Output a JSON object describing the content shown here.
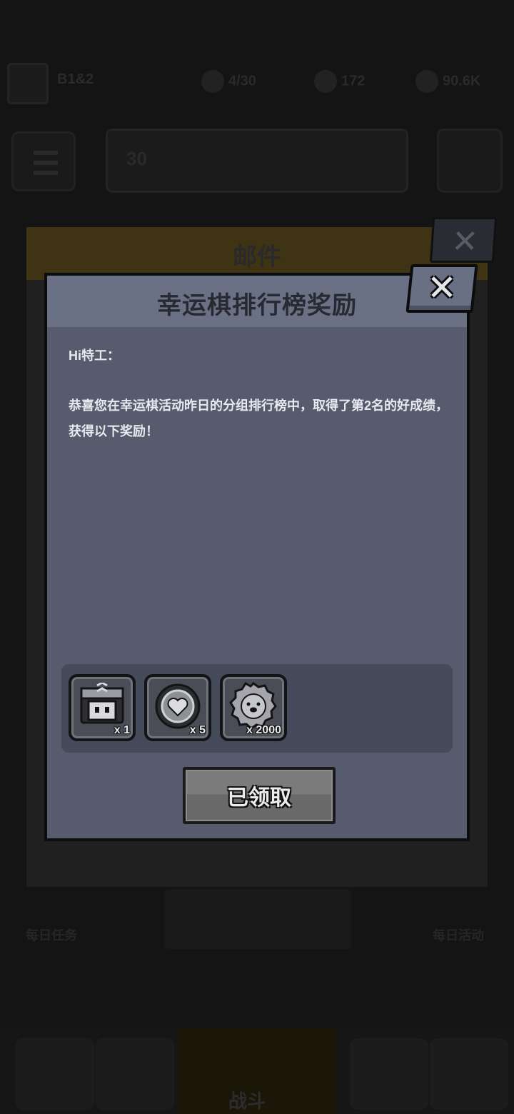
{
  "background": {
    "player_name": "B1&2",
    "resources": [
      {
        "icon": "energy-icon",
        "value": "4/30"
      },
      {
        "icon": "gem-icon",
        "value": "172"
      },
      {
        "icon": "coin-icon",
        "value": "90.6K"
      }
    ],
    "level": "30",
    "mail_window_title": "邮件",
    "bottom_labels": {
      "left": "每日任务",
      "right": "每日活动"
    },
    "battle_label": "战斗"
  },
  "dialog": {
    "title": "幸运棋排行榜奖励",
    "greeting": "Hi特工：",
    "body": "恭喜您在幸运棋活动昨日的分组排行榜中，取得了第2名的好成绩，获得以下奖励！",
    "rewards": [
      {
        "icon": "treasure-chest-icon",
        "count": "x 1"
      },
      {
        "icon": "heart-orb-icon",
        "count": "x 5"
      },
      {
        "icon": "paw-coin-icon",
        "count": "x 2000"
      }
    ],
    "claim_button": "已领取",
    "close_icon": "close-icon"
  },
  "colors": {
    "dialog_body": "#565c6e",
    "dialog_header": "#6b7184",
    "reward_panel": "#464b5c",
    "claimed_button": "#747474"
  }
}
